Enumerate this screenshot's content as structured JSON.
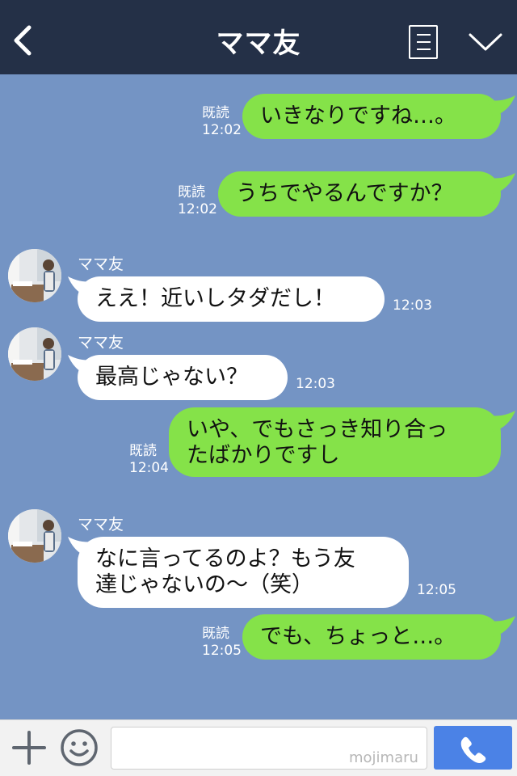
{
  "header": {
    "title": "ママ友"
  },
  "sender_name": "ママ友",
  "read_label": "既読",
  "messages": [
    {
      "text": "いきなりですね…。",
      "time": "12:02"
    },
    {
      "text": "うちでやるんですか？",
      "time": "12:02"
    },
    {
      "text": "ええ！近いしタダだし！",
      "time": "12:03"
    },
    {
      "text": "最高じゃない？",
      "time": "12:03"
    },
    {
      "line1": "いや、でもさっき知り合っ",
      "line2": "たばかりですし",
      "time": "12:04"
    },
    {
      "line1": "なに言ってるのよ？もう友",
      "line2": "達じゃないの～（笑）",
      "time": "12:05"
    },
    {
      "text": "でも、ちょっと…。",
      "time": "12:05"
    }
  ],
  "input": {
    "placeholder": "",
    "value": "",
    "watermark": "mojimaru"
  },
  "colors": {
    "header": "#243047",
    "background": "#7494c4",
    "sent_bubble": "#85e249",
    "received_bubble": "#ffffff",
    "call_button": "#4b82e6"
  }
}
